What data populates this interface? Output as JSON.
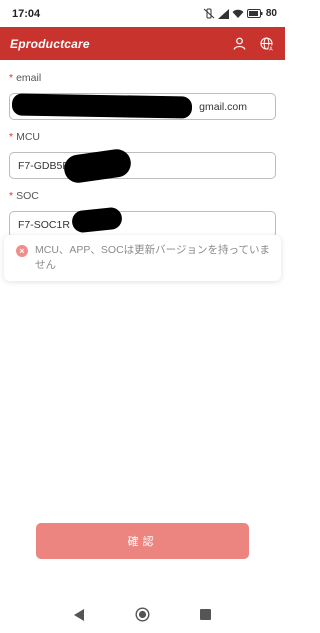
{
  "status": {
    "time": "17:04",
    "battery": "80"
  },
  "header": {
    "title": "Eproductcare",
    "icons": [
      "user-icon",
      "language-icon"
    ]
  },
  "form": {
    "email": {
      "required_mark": "*",
      "label": "email",
      "value_suffix": "gmail.com"
    },
    "mcu": {
      "required_mark": "*",
      "label": "MCU",
      "value_prefix": "F7-GDB5P"
    },
    "soc": {
      "required_mark": "*",
      "label": "SOC",
      "value_prefix": "F7-SOC1R"
    }
  },
  "toast": {
    "icon": "close-circle-icon",
    "message": "MCU、APP、SOCは更新バージョンを持っていません"
  },
  "confirm_button": {
    "label": "確認"
  },
  "nav": {
    "icons": [
      "back-icon",
      "home-icon",
      "recents-icon"
    ]
  },
  "colors": {
    "header": "#c8332e",
    "button": "#ec8480",
    "required": "#d9342b"
  }
}
